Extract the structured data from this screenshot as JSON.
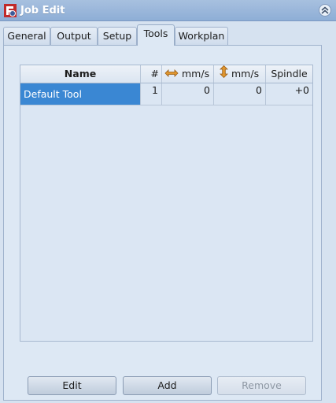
{
  "window": {
    "title": "Job Edit",
    "icon": "freecad-app-icon",
    "collapse_icon": "double-chevron-up-icon"
  },
  "tabs": [
    {
      "label": "General",
      "active": false
    },
    {
      "label": "Output",
      "active": false
    },
    {
      "label": "Setup",
      "active": false
    },
    {
      "label": "Tools",
      "active": true
    },
    {
      "label": "Workplan",
      "active": false
    }
  ],
  "table": {
    "columns": [
      {
        "label": "Name"
      },
      {
        "label": "#"
      },
      {
        "label": "mm/s",
        "icon": "horizontal-arrows-icon"
      },
      {
        "label": "mm/s",
        "icon": "vertical-arrows-icon"
      },
      {
        "label": "Spindle"
      }
    ],
    "rows": [
      {
        "name": "Default Tool",
        "number": "1",
        "h_feed": "0",
        "v_feed": "0",
        "spindle": "+0",
        "selected": true
      }
    ]
  },
  "buttons": {
    "edit": "Edit",
    "add": "Add",
    "remove": "Remove"
  },
  "colors": {
    "selection": "#3a87d3",
    "titlebar": "#94b3da",
    "arrow_icon": "#e0962e"
  }
}
